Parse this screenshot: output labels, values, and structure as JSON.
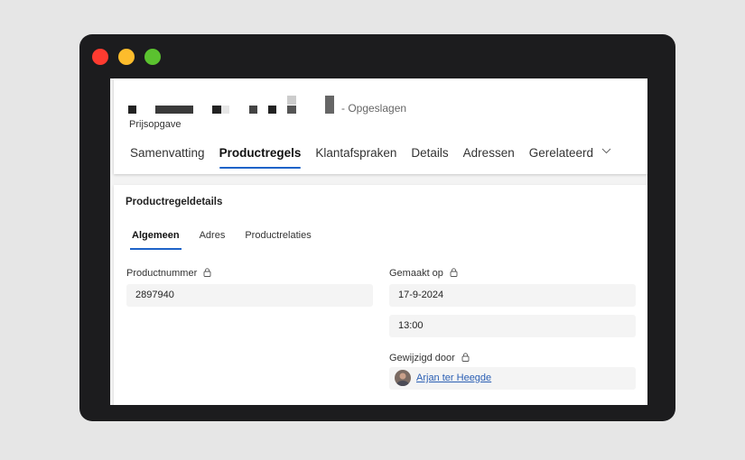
{
  "window": {
    "controls": [
      "close",
      "minimize",
      "maximize"
    ],
    "colors": {
      "close": "#fe3b30",
      "minimize": "#fdbc2c",
      "maximize": "#5bc22f"
    }
  },
  "header": {
    "save_status": "- Opgeslagen",
    "entity_type": "Prijsopgave"
  },
  "tabs": [
    "Samenvatting",
    "Productregels",
    "Klantafspraken",
    "Details",
    "Adressen",
    "Gerelateerd"
  ],
  "active_tab": "Productregels",
  "card": {
    "title": "Productregeldetails",
    "subtabs": [
      "Algemeen",
      "Adres",
      "Productrelaties"
    ],
    "fields": {
      "productnummer": {
        "label": "Productnummer",
        "value": "2897940"
      },
      "gemaakt_op": {
        "label": "Gemaakt op",
        "date": "17-9-2024",
        "time": "13:00"
      },
      "gewijzigd_door": {
        "label": "Gewijzigd door",
        "value": "Arjan ter Heegde"
      }
    }
  },
  "accent": "#1e63c8"
}
